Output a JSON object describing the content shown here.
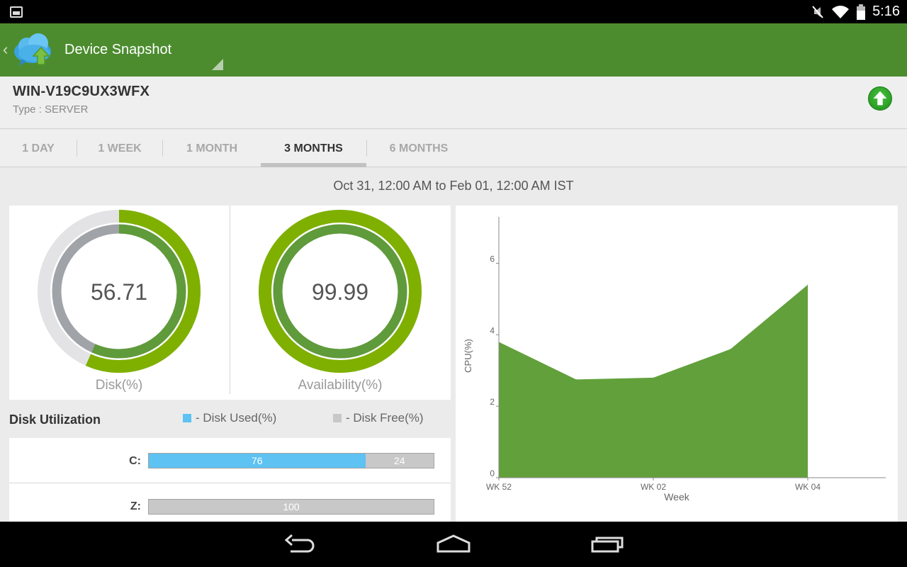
{
  "status_bar": {
    "time": "5:16"
  },
  "action_bar": {
    "title": "Device Snapshot"
  },
  "device": {
    "name": "WIN-V19C9UX3WFX",
    "type": "Type : SERVER"
  },
  "tabs": [
    {
      "label": "1 DAY",
      "active": false
    },
    {
      "label": "1 WEEK",
      "active": false
    },
    {
      "label": "1 MONTH",
      "active": false
    },
    {
      "label": "3 MONTHS",
      "active": true
    },
    {
      "label": "6 MONTHS",
      "active": false
    }
  ],
  "date_range": "Oct 31, 12:00 AM to Feb 01, 12:00 AM IST",
  "gauges": [
    {
      "value": "56.71",
      "percent": 56.71,
      "label": "Disk(%)"
    },
    {
      "value": "99.99",
      "percent": 99.99,
      "label": "Availability(%)"
    }
  ],
  "disk_utilization": {
    "title": "Disk Utilization",
    "legend_used": "- Disk Used(%)",
    "legend_free": "- Disk Free(%)",
    "colors": {
      "used": "#5ec2f2",
      "free": "#c8c8c8"
    },
    "drives": [
      {
        "label": "C:",
        "used": 76,
        "free": 24,
        "used_label": "76",
        "free_label": "24"
      },
      {
        "label": "Z:",
        "used": 0,
        "free": 100,
        "used_label": "",
        "free_label": "100"
      }
    ]
  },
  "chart_data": {
    "type": "area",
    "xlabel": "Week",
    "ylabel": "CPU(%)",
    "x_tick_labels": [
      "WK 52",
      "WK 02",
      "WK 04"
    ],
    "y_ticks": [
      "0",
      "2",
      "4",
      "6"
    ],
    "ylim": [
      0,
      7.3
    ],
    "points": [
      {
        "x": "WK 52",
        "y": 3.8
      },
      {
        "x": "",
        "y": 2.75
      },
      {
        "x": "WK 02",
        "y": 2.8
      },
      {
        "x": "",
        "y": 3.6
      },
      {
        "x": "WK 04",
        "y": 5.4
      }
    ],
    "color": "#62a03b",
    "grid": false
  }
}
